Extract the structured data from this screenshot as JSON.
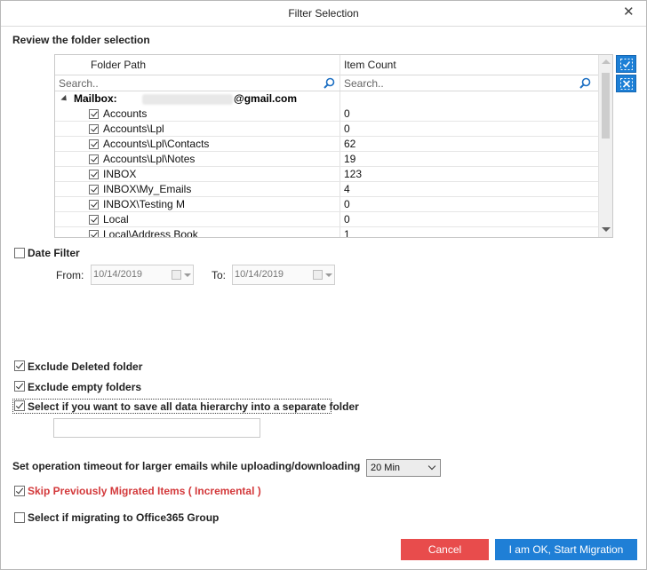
{
  "window": {
    "title": "Filter Selection"
  },
  "review_label": "Review the folder selection",
  "grid": {
    "columns": [
      "Folder Path",
      "Item Count"
    ],
    "search_placeholders": [
      "Search..",
      "Search.."
    ],
    "mailbox": {
      "prefix": "Mailbox:",
      "domain": "@gmail.com"
    },
    "rows": [
      {
        "path": "Accounts",
        "count": "0"
      },
      {
        "path": "Accounts\\Lpl",
        "count": "0"
      },
      {
        "path": "Accounts\\Lpl\\Contacts",
        "count": "62"
      },
      {
        "path": "Accounts\\Lpl\\Notes",
        "count": "19"
      },
      {
        "path": "INBOX",
        "count": "123"
      },
      {
        "path": "INBOX\\My_Emails",
        "count": "4"
      },
      {
        "path": "INBOX\\Testing M",
        "count": "0"
      },
      {
        "path": "Local",
        "count": "0"
      },
      {
        "path": "Local\\Address Book",
        "count": "1"
      }
    ]
  },
  "date_filter": {
    "label": "Date Filter",
    "from_label": "From:",
    "to_label": "To:",
    "from_value": "10/14/2019",
    "to_value": "10/14/2019"
  },
  "options": {
    "exclude_deleted": "Exclude Deleted folder",
    "exclude_empty": "Exclude empty folders",
    "save_hierarchy": "Select if you want to save all data hierarchy into a separate folder"
  },
  "timeout": {
    "label": "Set operation timeout for larger emails while uploading/downloading",
    "value": "20 Min"
  },
  "skip_migrated": "Skip Previously Migrated Items ( Incremental )",
  "office365_group": "Select if migrating to Office365 Group",
  "buttons": {
    "cancel": "Cancel",
    "ok": "I am OK, Start Migration"
  },
  "colors": {
    "accent": "#1f7fd6",
    "cancel": "#e84c4c",
    "skip_label": "#d3393b"
  }
}
